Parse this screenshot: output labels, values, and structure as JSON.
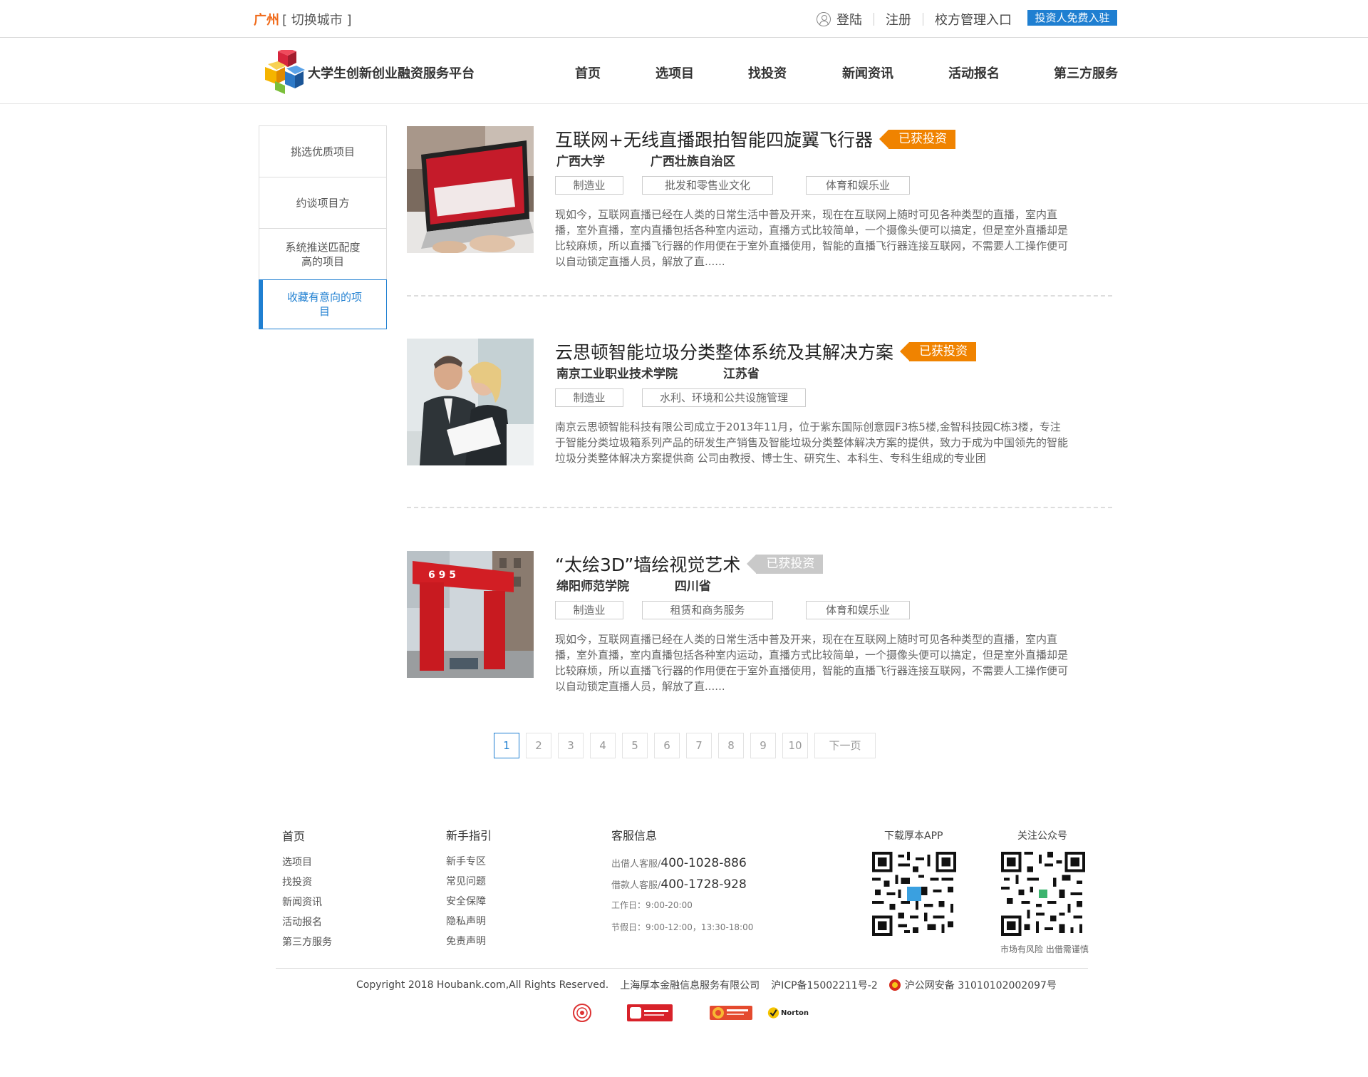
{
  "topbar": {
    "city": "广州",
    "switch_city": "[ 切换城市 ]",
    "login": "登陆",
    "register": "注册",
    "school_admin": "校方管理入口",
    "investor_join": "投资人免费入驻"
  },
  "header": {
    "site_title": "大学生创新创业融资服务平台",
    "nav": [
      "首页",
      "选项目",
      "找投资",
      "新闻资讯",
      "活动报名",
      "第三方服务"
    ]
  },
  "sidebar": {
    "items": [
      {
        "label": "挑选优质项目"
      },
      {
        "label": "约谈项目方"
      },
      {
        "label": "系统推送匹配度高的项目"
      },
      {
        "label": "收藏有意向的项目"
      }
    ],
    "active_index": 3
  },
  "projects": [
    {
      "title": "互联网+无线直播跟拍智能四旋翼飞行器",
      "status": "已获投资",
      "status_active": true,
      "school": "广西大学",
      "region": "广西壮族自治区",
      "tags": [
        "制造业",
        "批发和零售业文化",
        "体育和娱乐业"
      ],
      "description": "现如今，互联网直播已经在人类的日常生活中普及开来，现在在互联网上随时可见各种类型的直播，室内直播，室外直播，室内直播包括各种室内运动，直播方式比较简单，一个摄像头便可以搞定，但是室外直播却是比较麻烦，所以直播飞行器的作用便在于室外直播使用，智能的直播飞行器连接互联网，不需要人工操作便可以自动锁定直播人员，解放了直......"
    },
    {
      "title": "云思顿智能垃圾分类整体系统及其解决方案",
      "status": "已获投资",
      "status_active": true,
      "school": "南京工业职业技术学院",
      "region": "江苏省",
      "tags": [
        "制造业",
        "水利、环境和公共设施管理"
      ],
      "description": "南京云思顿智能科技有限公司成立于2013年11月，位于紫东国际创意园F3栋5楼,金智科技园C栋3楼，专注于智能分类垃圾箱系列产品的研发生产销售及智能垃圾分类整体解决方案的提供，致力于成为中国领先的智能垃圾分类整体解决方案提供商 公司由教授、博士生、研究生、本科生、专科生组成的专业团"
    },
    {
      "title": "“太绘3D”墙绘视觉艺术",
      "status": "已获投资",
      "status_active": false,
      "school": "绵阳师范学院",
      "region": "四川省",
      "tags": [
        "制造业",
        "租赁和商务服务",
        "体育和娱乐业"
      ],
      "description": "现如今，互联网直播已经在人类的日常生活中普及开来，现在在互联网上随时可见各种类型的直播，室内直播，室外直播，室内直播包括各种室内运动，直播方式比较简单，一个摄像头便可以搞定，但是室外直播却是比较麻烦，所以直播飞行器的作用便在于室外直播使用，智能的直播飞行器连接互联网，不需要人工操作便可以自动锁定直播人员，解放了直......"
    }
  ],
  "pagination": {
    "pages": [
      "1",
      "2",
      "3",
      "4",
      "5",
      "6",
      "7",
      "8",
      "9",
      "10"
    ],
    "current": 1,
    "next": "下一页"
  },
  "footer": {
    "col1": {
      "head": "首页",
      "links": [
        "选项目",
        "找投资",
        "新闻资讯",
        "活动报名",
        "第三方服务"
      ]
    },
    "col2": {
      "head": "新手指引",
      "links": [
        "新手专区",
        "常见问题",
        "安全保障",
        "隐私声明",
        "免责声明"
      ]
    },
    "service": {
      "head": "客服信息",
      "lender_label": "出借人客服/",
      "lender_phone": "400-1028-886",
      "borrower_label": "借款人客服/",
      "borrower_phone": "400-1728-928",
      "workday": "工作日：9:00-20:00",
      "holiday": "节假日：9:00-12:00，13:30-18:00"
    },
    "app_label": "下载厚本APP",
    "wechat_label": "关注公众号",
    "risk_note": "市场有风险 出借需谨慎",
    "copyright": "Copyright 2018 Houbank.com,All Rights Reserved.",
    "company": "上海厚本金融信息服务有限公司",
    "icp": "沪ICP备15002211号-2",
    "police": "沪公网安备 31010102002097号",
    "cert_norton": "Norton"
  }
}
